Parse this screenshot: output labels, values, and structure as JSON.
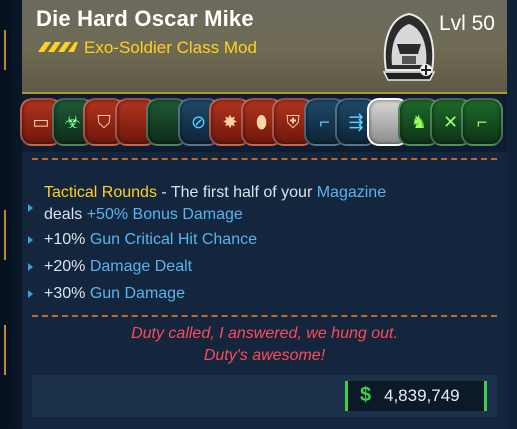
{
  "item": {
    "name": "Die Hard Oscar Mike",
    "type": "Exo-Soldier Class Mod",
    "level": "Lvl 50",
    "rarity_icon": "rarity-chevrons-icon",
    "portrait_icon": "hooded-soldier-portrait-icon"
  },
  "skills": [
    {
      "icon": "ammo-crate-icon",
      "color": "red",
      "glyph": "▭"
    },
    {
      "icon": "biohazard-icon",
      "color": "green",
      "glyph": "☣"
    },
    {
      "icon": "shield-crest-icon",
      "color": "red",
      "glyph": "⛉"
    },
    {
      "icon": "blank-red-icon",
      "color": "red",
      "glyph": ""
    },
    {
      "icon": "blank-green-icon",
      "color": "green",
      "glyph": ""
    },
    {
      "icon": "no-entry-icon",
      "color": "blue",
      "glyph": "⊘"
    },
    {
      "icon": "blast-icon",
      "color": "red",
      "glyph": "✸"
    },
    {
      "icon": "beetle-icon",
      "color": "red",
      "glyph": "⬮"
    },
    {
      "icon": "shield-icon",
      "color": "red",
      "glyph": "⛨"
    },
    {
      "icon": "rifle-icon",
      "color": "blue",
      "glyph": "⌐"
    },
    {
      "icon": "arrows-icon",
      "color": "blue",
      "glyph": "⇶"
    },
    {
      "icon": "selected-blank-icon",
      "color": "white",
      "glyph": ""
    },
    {
      "icon": "robot-icon",
      "color": "lime",
      "glyph": "♞"
    },
    {
      "icon": "crossed-swords-icon",
      "color": "lime",
      "glyph": "✕"
    },
    {
      "icon": "pistol-icon",
      "color": "lime",
      "glyph": "⌐"
    }
  ],
  "stats": {
    "primary_name": "Tactical Rounds",
    "primary_sep": " - The first half of your ",
    "primary_mag": "Magazine",
    "primary_deals": "deals ",
    "primary_bonus": "+50% Bonus Damage",
    "lines": [
      {
        "value": "+10% ",
        "label": "Gun Critical Hit Chance"
      },
      {
        "value": "+20% ",
        "label": "Damage Dealt"
      },
      {
        "value": "+30% ",
        "label": "Gun Damage"
      }
    ]
  },
  "flavor": {
    "line1": "Duty called, I answered, we hung out.",
    "line2": "Duty's awesome!"
  },
  "price": {
    "symbol": "$",
    "value": "4,839,749"
  },
  "colors": {
    "header_gold": "#b8922c",
    "type_yellow": "#ffd21f",
    "stat_cyan": "#58b4f0",
    "flavor_red": "#ff4a5a",
    "money_green": "#3ecf4a"
  }
}
